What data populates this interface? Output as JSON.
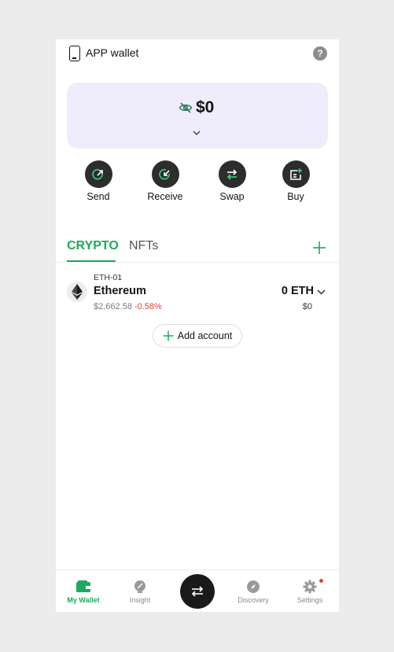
{
  "header": {
    "title": "APP wallet",
    "help_label": "?"
  },
  "balance": {
    "amount": "$0"
  },
  "actions": [
    {
      "label": "Send",
      "icon": "send-icon"
    },
    {
      "label": "Receive",
      "icon": "receive-icon"
    },
    {
      "label": "Swap",
      "icon": "swap-icon"
    },
    {
      "label": "Buy",
      "icon": "buy-icon"
    }
  ],
  "tabs": {
    "crypto": "CRYPTO",
    "nfts": "NFTs"
  },
  "assets": [
    {
      "account_id": "ETH-01",
      "name": "Ethereum",
      "price": "$2,662.58",
      "change": "-0.58%",
      "balance": "0 ETH",
      "fiat_balance": "$0"
    }
  ],
  "add_account": {
    "label": "Add account"
  },
  "nav": {
    "items": [
      {
        "label": "My Wallet",
        "icon": "wallet-icon"
      },
      {
        "label": "Insight",
        "icon": "insight-icon"
      },
      {
        "label": "Discovery",
        "icon": "compass-icon"
      },
      {
        "label": "Settings",
        "icon": "gear-icon"
      }
    ]
  },
  "colors": {
    "accent": "#1bab5e",
    "negative": "#e0453a",
    "card_bg": "#efedfc",
    "dark": "#2d2d2d"
  }
}
